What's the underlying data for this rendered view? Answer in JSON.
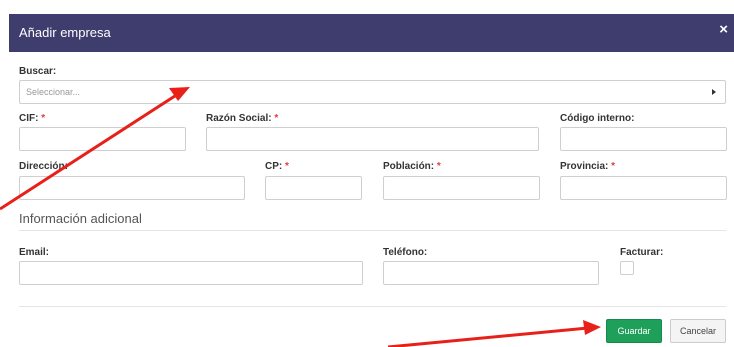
{
  "modal": {
    "title": "Añadir empresa",
    "close_symbol": "×"
  },
  "form": {
    "buscar": {
      "label": "Buscar:",
      "placeholder": "Seleccionar..."
    },
    "cif": {
      "label": "CIF:",
      "required_mark": "*",
      "value": ""
    },
    "razon_social": {
      "label": "Razón Social:",
      "required_mark": "*",
      "value": ""
    },
    "codigo_interno": {
      "label": "Código interno:",
      "value": ""
    },
    "direccion": {
      "label": "Dirección:",
      "value": ""
    },
    "cp": {
      "label": "CP:",
      "required_mark": "*",
      "value": ""
    },
    "poblacion": {
      "label": "Población:",
      "required_mark": "*",
      "value": ""
    },
    "provincia": {
      "label": "Provincia:",
      "required_mark": "*",
      "value": ""
    }
  },
  "additional": {
    "heading": "Información adicional",
    "email": {
      "label": "Email:",
      "value": ""
    },
    "telefono": {
      "label": "Teléfono:",
      "value": ""
    },
    "facturar": {
      "label": "Facturar:",
      "checked": false
    }
  },
  "footer": {
    "save_label": "Guardar",
    "cancel_label": "Cancelar"
  },
  "colors": {
    "header": "#3f3c6e",
    "save_button": "#1fa05a",
    "annotation_arrow": "#e8201a",
    "required": "#e04040"
  }
}
